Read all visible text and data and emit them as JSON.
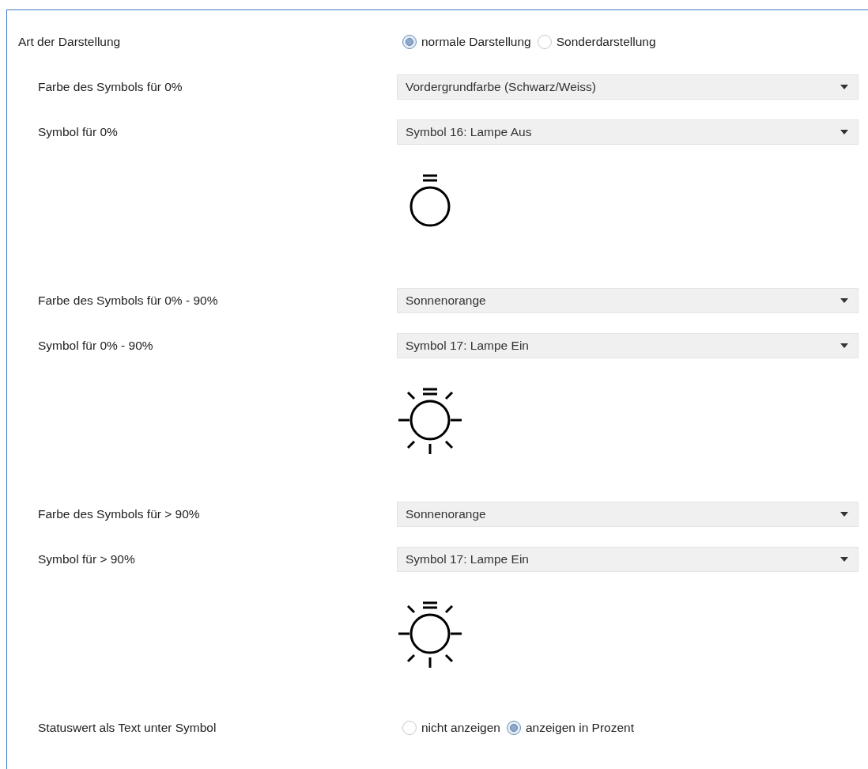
{
  "rows": [
    {
      "kind": "radio",
      "label": "Art der Darstellung",
      "options": [
        {
          "label": "normale Darstellung",
          "selected": true
        },
        {
          "label": "Sonderdarstellung",
          "selected": false
        }
      ],
      "children": [
        {
          "kind": "dropdown",
          "label": "Farbe des Symbols für 0%",
          "value": "Vordergrundfarbe (Schwarz/Weiss)"
        },
        {
          "kind": "dropdown",
          "label": "Symbol für 0%",
          "value": "Symbol 16: Lampe Aus"
        },
        {
          "kind": "preview",
          "lit": false
        },
        {
          "kind": "dropdown",
          "label": "Farbe des Symbols für 0% - 90%",
          "value": "Sonnenorange"
        },
        {
          "kind": "dropdown",
          "label": "Symbol für 0% - 90%",
          "value": "Symbol 17: Lampe Ein"
        },
        {
          "kind": "preview",
          "lit": true
        },
        {
          "kind": "dropdown",
          "label": "Farbe des Symbols für > 90%",
          "value": "Sonnenorange"
        },
        {
          "kind": "dropdown",
          "label": "Symbol für > 90%",
          "value": "Symbol 17: Lampe Ein"
        },
        {
          "kind": "preview",
          "lit": true
        },
        {
          "kind": "radio",
          "label": "Statuswert als Text unter Symbol",
          "options": [
            {
              "label": "nicht anzeigen",
              "selected": false
            },
            {
              "label": "anzeigen in Prozent",
              "selected": true
            }
          ]
        }
      ]
    }
  ]
}
